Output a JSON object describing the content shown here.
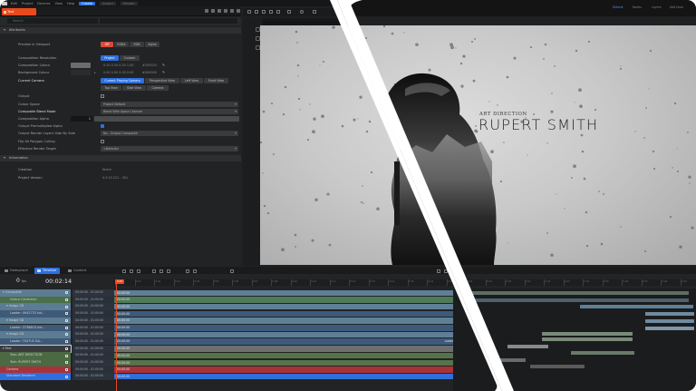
{
  "menu": {
    "items": [
      "Edit",
      "Project",
      "Devices",
      "View",
      "Help"
    ],
    "active": "Create",
    "dim1": "Import",
    "dim2": "Render"
  },
  "node": {
    "title": "Text"
  },
  "search": {
    "placeholder": "Search"
  },
  "sections": {
    "attributes": "Attributes",
    "information": "Information"
  },
  "preview": {
    "label": "Preview in Viewport",
    "options": [
      "Off",
      "RGBA",
      "RGB",
      "Alpha"
    ],
    "active": "Off"
  },
  "composition": {
    "resolution_label": "Composition Resolution",
    "resolution_options": [
      "Project",
      "Custom"
    ],
    "colour_label": "Composition Colour",
    "colour_value": "0.20 0.20 0.20 1.00",
    "colour_hex": "#333333",
    "background_label": "Background Colour",
    "background_value": "0.00 0.00 0.00 0.00",
    "background_hex": "#000000",
    "camera_label": "Current Camera",
    "camera_options": [
      "Current Playing Camera",
      "Perspective View",
      "Left View",
      "Front View",
      "Top View",
      "Side View",
      "Camera"
    ],
    "camera_active": "Current Playing Camera",
    "colour_hex_color": "#6c6c6c",
    "background_hex_color": "#2b2c2d"
  },
  "output": {
    "output_label": "Output",
    "colour_space_label": "Colour Space",
    "colour_space_value": "Project Default",
    "blend_label": "Composite Blend Mode",
    "blend_value": "Blend With Alpha Channel",
    "alpha_label": "Composition Alpha",
    "alpha_value": "1",
    "premult_label": "Output Premultiplied Alpha",
    "render_layers_label": "Output Render Layers Side By Side",
    "render_layers_value": "No - Output Composite",
    "flip_label": "Flip All Polygon Culling",
    "effective_label": "Effective Render Target",
    "effective_value": "<Default>"
  },
  "information": {
    "created_label": "Creation",
    "created_value": "Notch",
    "version_label": "Project Version",
    "version_value": "0.9.23.221 - 301"
  },
  "viewport": {
    "subtitle": "ART DIRECTION",
    "name": "RUPERT SMITH"
  },
  "right_header": {
    "tabs": [
      "Default",
      "Nodes",
      "Layers",
      "Add Dock"
    ]
  },
  "bottom_tabs": [
    "Nodegraph",
    "Timeline",
    "Content"
  ],
  "bottom_active": "Timeline",
  "timeline": {
    "fps": "0",
    "fps_unit": "fps",
    "timecode": "00:02:14",
    "playhead_label": "0:00",
    "ruler_ticks": [
      "0:00",
      "0:01",
      "0:02",
      "0:03",
      "0:04",
      "0:05",
      "0:06",
      "0:07",
      "0:08",
      "0:09",
      "0:10",
      "0:11",
      "0:12",
      "0:13",
      "0:14",
      "0:15",
      "0:16",
      "0:17",
      "0:18",
      "0:19",
      "0:20",
      "0:21",
      "0:22",
      "0:23",
      "0:24",
      "0:25",
      "0:26",
      "0:27",
      "0:28",
      "0:29"
    ],
    "layers": [
      {
        "name": "Composite",
        "indent": 0,
        "color": "#5b7c93",
        "expanded": true,
        "range": "00:00:00 - 01:00:00",
        "start": "00:00:00",
        "bar": "",
        "bar_color": "#5f7f96"
      },
      {
        "name": "Colour Correction",
        "indent": 2,
        "color": "#4a6f4a",
        "range": "00:00:00 - 01:00:00",
        "start": "00:00:00",
        "bar": "",
        "bar_color": "#4f7a56"
      },
      {
        "name": "Image 3D",
        "indent": 1,
        "color": "#5b7c93",
        "expanded": true,
        "range": "00:00:00 - 01:00:00",
        "start": "00:00:00",
        "bar": "",
        "bar_color": "#5f7f96"
      },
      {
        "name": "Loader: 4942733 Ind...",
        "indent": 2,
        "color": "#3f5a78",
        "range": "00:00:00 - 01:00:00",
        "start": "00:00:00",
        "bar": "Loader: 4942733 Indi",
        "bar_color": "#3d5a7a"
      },
      {
        "name": "Image 3D",
        "indent": 1,
        "color": "#5b7c93",
        "expanded": true,
        "range": "00:00:00 - 01:00:00",
        "start": "00:00:00",
        "bar": "Image",
        "bar_color": "#5f7f96"
      },
      {
        "name": "Loader: 3738803 Ind...",
        "indent": 2,
        "color": "#3f5a78",
        "range": "00:00:00 - 01:00:00",
        "start": "00:00:00",
        "bar": "Loader: 3738803 Ind",
        "bar_color": "#3d5a7a"
      },
      {
        "name": "Image 2D",
        "indent": 1,
        "color": "#5b7c93",
        "expanded": true,
        "range": "00:00:00 - 01:00:00",
        "start": "00:00:00",
        "bar": "Image",
        "bar_color": "#5f7f96"
      },
      {
        "name": "Loader: TEXTUC.BA...",
        "indent": 2,
        "color": "#3f5a78",
        "range": "00:00:00 - 01:00:00",
        "start": "00:00:00",
        "bar": "Loader: TEXTUC.Backdrop_Cha",
        "bar_color": "#3d5a7a"
      },
      {
        "name": "Text",
        "indent": 0,
        "color": "#3a3b3c",
        "expanded": true,
        "selected": true,
        "range": "00:00:00 - 01:00:00",
        "start": "00:00:00",
        "bar": "Text",
        "bar_color": "#6d6e70"
      },
      {
        "name": "Text: ART DIRECTION",
        "indent": 2,
        "color": "#4b6a44",
        "range": "00:00:00 - 01:00:00",
        "start": "00:00:00",
        "bar": "Text: ART DIRECTION",
        "bar_color": "#56734a"
      },
      {
        "name": "Text: RUPERT SMITH",
        "indent": 2,
        "color": "#4b6a44",
        "range": "00:00:00 - 01:00:00",
        "start": "00:00:00",
        "bar": "Text: RUPERT SMITH",
        "bar_color": "#56734a"
      },
      {
        "name": "Camera",
        "indent": 1,
        "color": "#a8323a",
        "range": "00:00:00 - 01:00:00",
        "start": "00:00:00",
        "bar": "Camera",
        "bar_color": "#a8323a"
      },
      {
        "name": "Standard Renderer",
        "indent": 1,
        "color": "#2d6fe0",
        "range": "00:00:00 - 01:00:00",
        "start": "00:00:00",
        "bar": "Standard Renderer",
        "bar_color": "#2f6fd8"
      }
    ]
  }
}
